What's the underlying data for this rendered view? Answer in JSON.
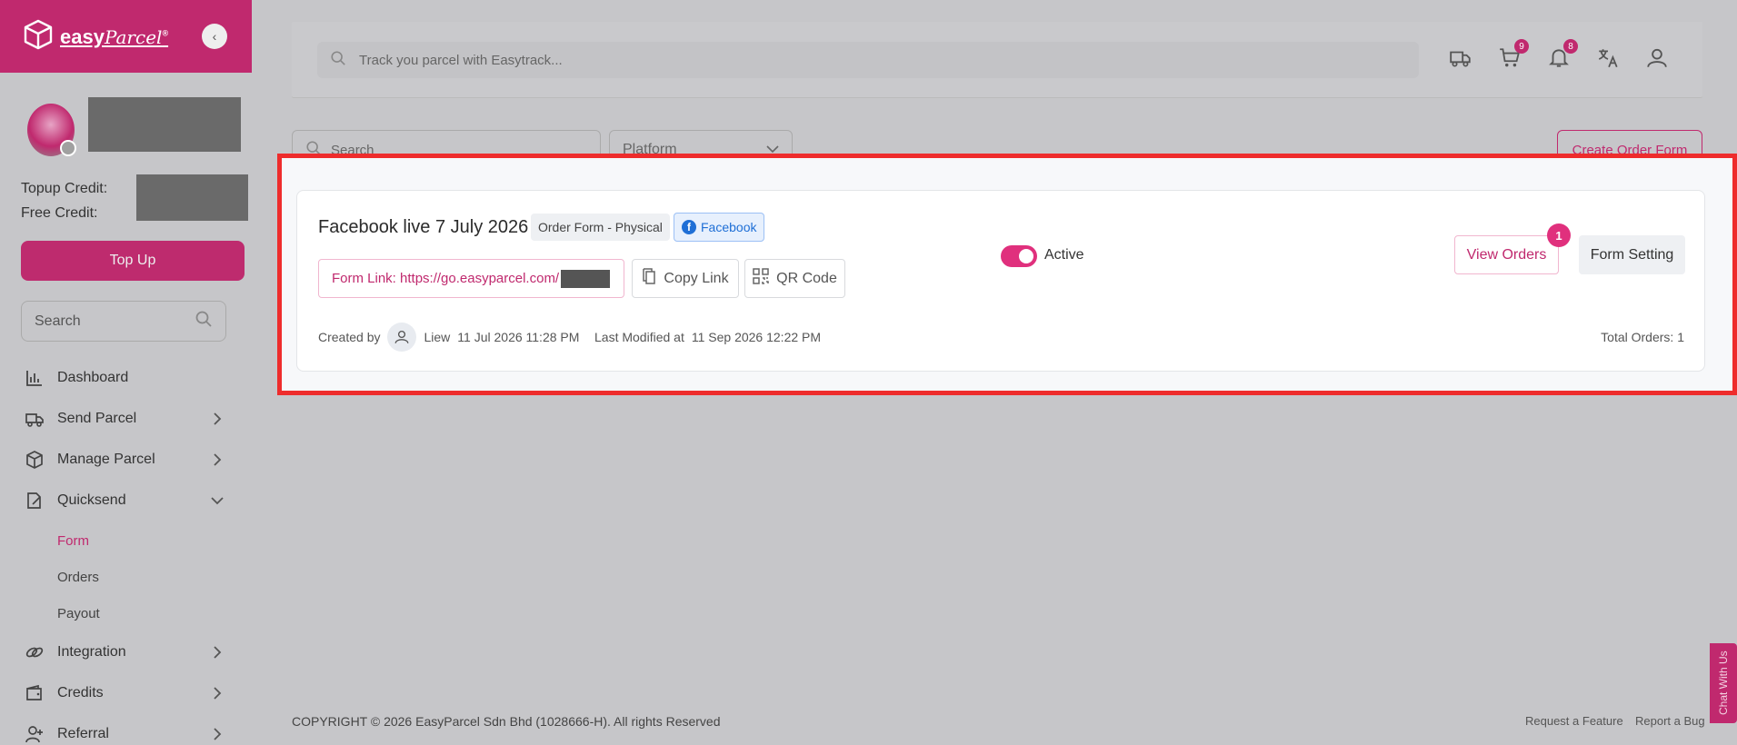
{
  "brand": {
    "name": "easy",
    "name_italic": "Parcel",
    "trademark": "®"
  },
  "sidebar": {
    "topup_credit_label": "Topup Credit:",
    "free_credit_label": "Free Credit:",
    "topup_button": "Top Up",
    "search_placeholder": "Search",
    "items": [
      {
        "label": "Dashboard",
        "icon": "chart-icon"
      },
      {
        "label": "Send Parcel",
        "icon": "truck-icon"
      },
      {
        "label": "Manage Parcel",
        "icon": "box-icon"
      },
      {
        "label": "Quicksend",
        "icon": "edit-doc-icon"
      },
      {
        "label": "Integration",
        "icon": "link-icon"
      },
      {
        "label": "Credits",
        "icon": "wallet-icon"
      },
      {
        "label": "Referral",
        "icon": "user-plus-icon"
      }
    ],
    "quicksend_sub": [
      "Form",
      "Orders",
      "Payout"
    ]
  },
  "header": {
    "track_placeholder": "Track you parcel with Easytrack...",
    "cart_count": "9",
    "notification_count": "8"
  },
  "filters": {
    "search_placeholder": "Search",
    "platform_placeholder": "Platform",
    "create_button": "Create Order Form"
  },
  "card": {
    "title": "Facebook live 7 July 2026",
    "type_tag": "Order Form - Physical",
    "platform_tag": "Facebook",
    "form_link": "Form Link: https://go.easyparcel.com/",
    "copy_link": "Copy Link",
    "qr_code": "QR Code",
    "status": "Active",
    "view_orders": "View Orders",
    "orders_badge": "1",
    "form_setting": "Form Setting",
    "created_by_label": "Created by",
    "creator": "Liew",
    "created_at": "11 Jul 2026 11:28 PM",
    "modified_label": "Last Modified at",
    "modified_at": "11 Sep 2026 12:22 PM",
    "total_orders": "Total Orders: 1"
  },
  "footer": {
    "copyright": "COPYRIGHT © 2026 EasyParcel Sdn Bhd (1028666-H). All rights Reserved",
    "request_feature": "Request a Feature",
    "report_bug": "Report a Bug",
    "chat": "Chat With Us"
  },
  "colors": {
    "brand": "#c0296e",
    "highlight_border": "#ee2c2c",
    "facebook": "#1f6fd6"
  }
}
